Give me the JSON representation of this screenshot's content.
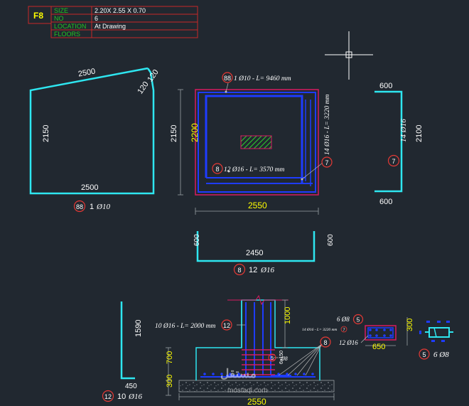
{
  "title_block": {
    "mark": "F8",
    "rows": [
      {
        "label": "SIZE",
        "value": "2.20X 2.55 X 0.70"
      },
      {
        "label": "NO",
        "value": "6"
      },
      {
        "label": "LOCATION",
        "value": "At Drawing"
      },
      {
        "label": "FLOORS",
        "value": ""
      }
    ]
  },
  "bar88": {
    "top_len": "2500",
    "hook1": "120",
    "hook2": "120",
    "left_len": "2150",
    "right_len": "2150",
    "bottom_len": "2500",
    "badge": "88",
    "caption_count": "1",
    "caption_dia": "Ø10"
  },
  "plan": {
    "bar88_note_badge": "88",
    "bar88_note": "1 Ø10 - L= 9460 mm",
    "height_dim": "2200",
    "width_dim": "2550",
    "bar8_badge": "8",
    "bar8_note": "12 Ø16 - L= 3570 mm",
    "bar7_badge": "7",
    "bar7_note": "14 Ø16 - L= 3220 mm"
  },
  "bar7": {
    "top": "600",
    "side": "2100",
    "bottom": "600",
    "badge": "7",
    "caption": "14 Ø16"
  },
  "bar8": {
    "left": "600",
    "right": "600",
    "bottom": "2450",
    "badge": "8",
    "caption_count": "12",
    "caption_dia": "Ø16"
  },
  "bar12": {
    "vertical": "1590",
    "horizontal": "450",
    "badge": "12",
    "caption_count": "10",
    "caption_dia": "Ø16"
  },
  "section": {
    "bar12_note": "10 Ø16 - L= 2000 mm",
    "bar12_badge": "12",
    "top_dim": "1000",
    "footing_dim": "700",
    "blinding_dim": "300",
    "width_dim": "2550",
    "stirrup_note": "Ø8",
    "stirrup_badge": "5",
    "spacing_note": "6x150",
    "bar8_badge": "8",
    "bar7_small": "14 Ø16 - L= 3220 mm",
    "bar7_small_badge": "7"
  },
  "col_section": {
    "stirrup_text": "6 Ø8",
    "stirrup_badge": "5",
    "bars_text": "12 Ø16",
    "bars_badge": "8",
    "width_dim": "650",
    "height_dim": "300"
  },
  "stirrup_shape": {
    "badge": "5",
    "caption": "6 Ø8"
  },
  "watermark": {
    "arabic": "مستقل",
    "latin": "mostaql.com"
  }
}
